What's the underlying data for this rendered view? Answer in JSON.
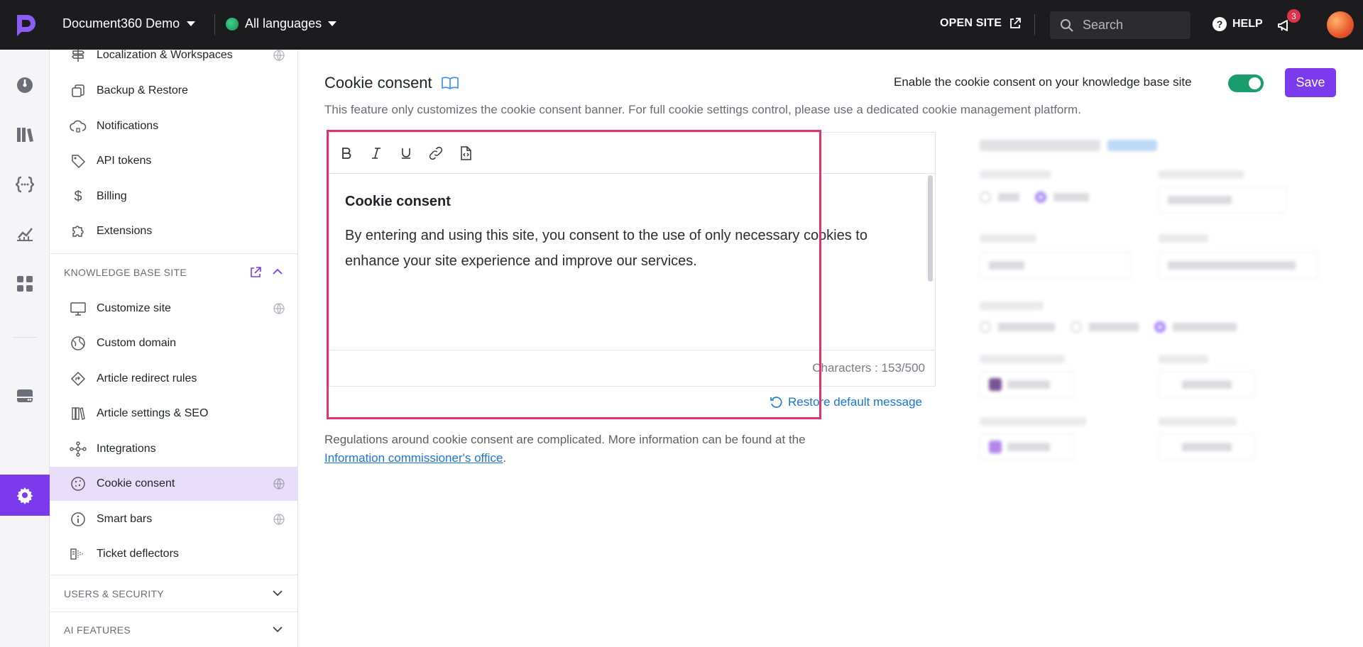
{
  "topbar": {
    "project_name": "Document360 Demo",
    "language": "All languages",
    "open_site": "OPEN SITE",
    "search_placeholder": "Search",
    "help": "HELP",
    "notification_count": "3"
  },
  "sidebar": {
    "items_top": [
      {
        "label": "Localization & Workspaces",
        "icon": "signpost-icon",
        "globe": true
      },
      {
        "label": "Backup & Restore",
        "icon": "backup-icon",
        "globe": false
      },
      {
        "label": "Notifications",
        "icon": "cloud-bell-icon",
        "globe": false
      },
      {
        "label": "API tokens",
        "icon": "tag-icon",
        "globe": false
      },
      {
        "label": "Billing",
        "icon": "dollar-icon",
        "globe": false
      },
      {
        "label": "Extensions",
        "icon": "puzzle-icon",
        "globe": false
      }
    ],
    "kb_section_title": "KNOWLEDGE BASE SITE",
    "items_kb": [
      {
        "label": "Customize site",
        "icon": "monitor-icon",
        "globe": true
      },
      {
        "label": "Custom domain",
        "icon": "domain-globe-icon",
        "globe": false
      },
      {
        "label": "Article redirect rules",
        "icon": "redirect-icon",
        "globe": false
      },
      {
        "label": "Article settings & SEO",
        "icon": "books-icon",
        "globe": false
      },
      {
        "label": "Integrations",
        "icon": "integrations-icon",
        "globe": false
      },
      {
        "label": "Cookie consent",
        "icon": "cookie-icon",
        "globe": true,
        "active": true
      },
      {
        "label": "Smart bars",
        "icon": "info-icon",
        "globe": true
      },
      {
        "label": "Ticket deflectors",
        "icon": "ticket-icon",
        "globe": false
      }
    ],
    "users_section_title": "USERS & SECURITY",
    "ai_section_title": "AI FEATURES"
  },
  "main": {
    "title": "Cookie consent",
    "subtitle": "This feature only customizes the cookie consent banner. For full cookie settings control, please use a dedicated cookie management platform.",
    "enable_label": "Enable the cookie consent on your knowledge base site",
    "enable_on": true,
    "save_label": "Save",
    "editor": {
      "heading": "Cookie consent",
      "body": "By entering and using this site, you consent to the use of only necessary cookies to enhance your site experience and improve our services.",
      "char_count": "Characters : 153/500"
    },
    "restore_label": "Restore default message",
    "regulations_text": "Regulations around cookie consent are complicated. More information can be found at the",
    "regulations_link": "Information commissioner's office",
    "regulations_end": "."
  },
  "colors": {
    "accent": "#7c3aed",
    "toggle_on": "#1a9d6e",
    "link": "#1976d2",
    "highlight_border": "#e0336f",
    "active_nav_bg": "#e9ddfc"
  }
}
